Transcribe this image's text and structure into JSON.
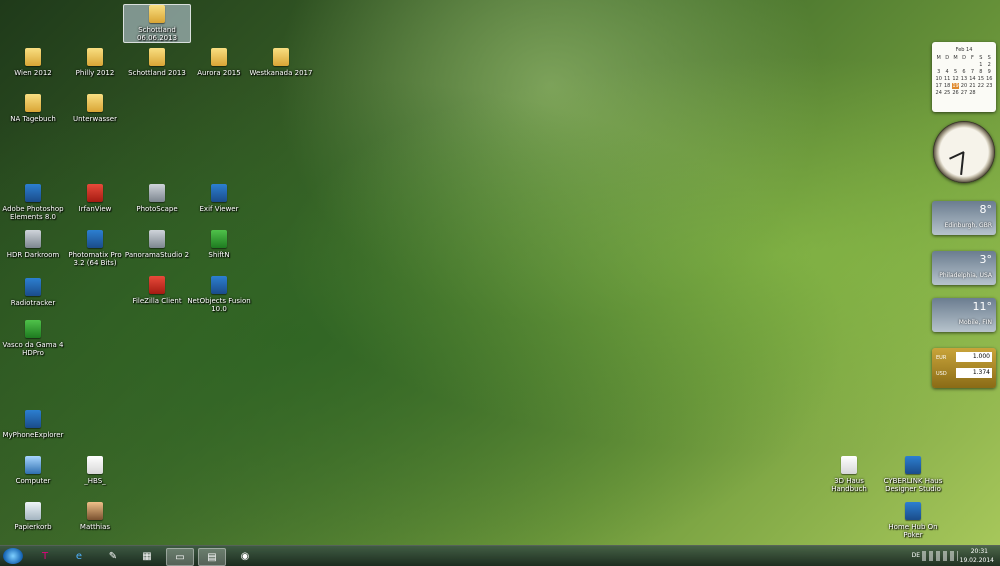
{
  "desktop": {
    "icons_left": [
      {
        "label": "Schottland 06.06.2013",
        "icon": "folder-icon"
      },
      {
        "label": "Wien 2012",
        "icon": "folder-icon"
      },
      {
        "label": "Philly 2012",
        "icon": "folder-icon"
      },
      {
        "label": "Schottland 2013",
        "icon": "folder-icon"
      },
      {
        "label": "Aurora 2015",
        "icon": "folder-icon"
      },
      {
        "label": "Westkanada 2017",
        "icon": "folder-icon"
      },
      {
        "label": "NA Tagebuch",
        "icon": "folder-icon"
      },
      {
        "label": "Unterwasser",
        "icon": "folder-icon"
      },
      {
        "label": "Adobe Photoshop Elements 8.0",
        "icon": "photoshop-icon"
      },
      {
        "label": "IrfanView",
        "icon": "irfanview-icon"
      },
      {
        "label": "PhotoScape",
        "icon": "photoscape-icon"
      },
      {
        "label": "Exif Viewer",
        "icon": "exif-icon"
      },
      {
        "label": "HDR Darkroom",
        "icon": "hdr-icon"
      },
      {
        "label": "Photomatix Pro 3.2 (64 Bits)",
        "icon": "photomatix-icon"
      },
      {
        "label": "PanoramaStudio 2",
        "icon": "panorama-icon"
      },
      {
        "label": "ShiftN",
        "icon": "shiftn-icon"
      },
      {
        "label": "Radiotracker",
        "icon": "radiotracker-icon"
      },
      {
        "label": "FileZilla Client",
        "icon": "filezilla-icon"
      },
      {
        "label": "NetObjects Fusion 10.0",
        "icon": "netobjects-icon"
      },
      {
        "label": "Vasco da Gama 4 HDPro",
        "icon": "vasco-icon"
      },
      {
        "label": "MyPhoneExplorer",
        "icon": "phone-icon"
      },
      {
        "label": "Computer",
        "icon": "computer-icon"
      },
      {
        "label": "_HBS_",
        "icon": "document-icon"
      },
      {
        "label": "Papierkorb",
        "icon": "recycle-bin-icon"
      },
      {
        "label": "Matthias",
        "icon": "user-folder-icon"
      }
    ],
    "icons_right": [
      {
        "label": "3D Haus Handbuch",
        "icon": "document-icon"
      },
      {
        "label": "CYBERLINK Haus Designer Studio",
        "icon": "app-icon"
      },
      {
        "label": "Home Hub On Poker",
        "icon": "app-icon"
      }
    ]
  },
  "gadgets": {
    "calendar": {
      "month": "Feb 14",
      "days": [
        "M",
        "D",
        "M",
        "D",
        "F",
        "S",
        "S"
      ],
      "dates": [
        "",
        "",
        "",
        "",
        "",
        "1",
        "2",
        "3",
        "4",
        "5",
        "6",
        "7",
        "8",
        "9",
        "10",
        "11",
        "12",
        "13",
        "14",
        "15",
        "16",
        "17",
        "18",
        "19",
        "20",
        "21",
        "22",
        "23",
        "24",
        "25",
        "26",
        "27",
        "28"
      ],
      "today": "19"
    },
    "weather": [
      {
        "temp": "8°",
        "city": "Edinburgh, GBR"
      },
      {
        "temp": "3°",
        "city": "Philadelphia, USA"
      },
      {
        "temp": "11°",
        "city": "Mobile, FIN"
      }
    ],
    "currency": [
      {
        "code": "EUR",
        "value": "1.000"
      },
      {
        "code": "USD",
        "value": "1.374"
      }
    ]
  },
  "taskbar": {
    "items": [
      {
        "name": "telekom-icon",
        "glyph": "T"
      },
      {
        "name": "internet-explorer-icon",
        "glyph": "e"
      },
      {
        "name": "paint-icon",
        "glyph": "✎"
      },
      {
        "name": "calculator-icon",
        "glyph": "▦"
      },
      {
        "name": "sticky-notes-icon",
        "glyph": "▭"
      },
      {
        "name": "explorer-icon",
        "glyph": "▤"
      },
      {
        "name": "google-earth-icon",
        "glyph": "◉"
      }
    ],
    "lang": "DE",
    "time": "20:31",
    "date": "19.02.2014"
  }
}
